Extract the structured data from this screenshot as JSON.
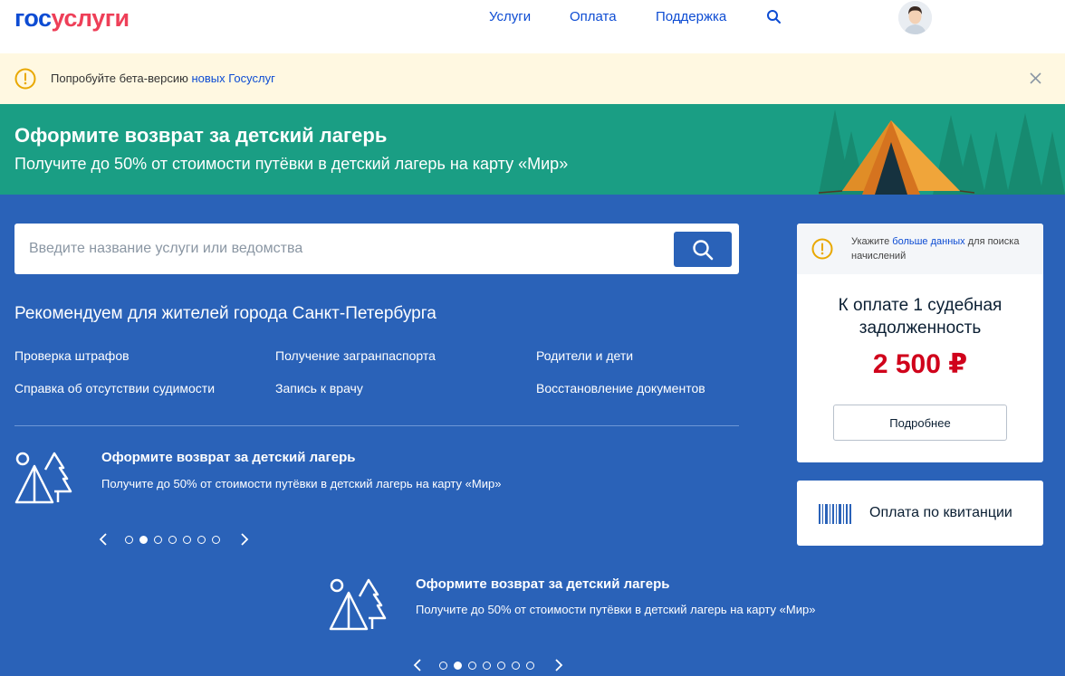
{
  "header": {
    "logo_part1": "гос",
    "logo_part2": "услуги",
    "nav": [
      "Услуги",
      "Оплата",
      "Поддержка"
    ]
  },
  "beta_notice": {
    "text": "Попробуйте бета-версию ",
    "link": "новых Госуслуг"
  },
  "banner": {
    "title": "Оформите возврат за детский лагерь",
    "subtitle": "Получите до 50% от стоимости путёвки в детский лагерь на карту «Мир»"
  },
  "search": {
    "placeholder": "Введите название услуги или ведомства"
  },
  "recommend": {
    "title": "Рекомендуем для жителей города Санкт-Петербурга",
    "links": [
      "Проверка штрафов",
      "Получение загранпаспорта",
      "Родители и дети",
      "Справка об отсутствии судимости",
      "Запись к врачу",
      "Восстановление документов"
    ]
  },
  "promo": {
    "title": "Оформите возврат за детский лагерь",
    "text": "Получите до 50% от стоимости путёвки в детский лагерь на карту «Мир»",
    "slides_total": 7,
    "active_slide": 2
  },
  "debt_card": {
    "hint_text": "Укажите ",
    "hint_link": "больше данных",
    "hint_tail": " для поиска начислений",
    "title": "К оплате 1 судебная задолженность",
    "amount": "2 500 ₽",
    "button": "Подробнее"
  },
  "receipt_card": {
    "label": "Оплата по квитанции"
  },
  "colors": {
    "brand_blue": "#0d4cd3",
    "brand_red": "#ee3f58",
    "main_bg": "#2a62b8",
    "banner_bg": "#1a9e84",
    "notice_bg": "#fff8e1",
    "amount": "#d0021b"
  }
}
